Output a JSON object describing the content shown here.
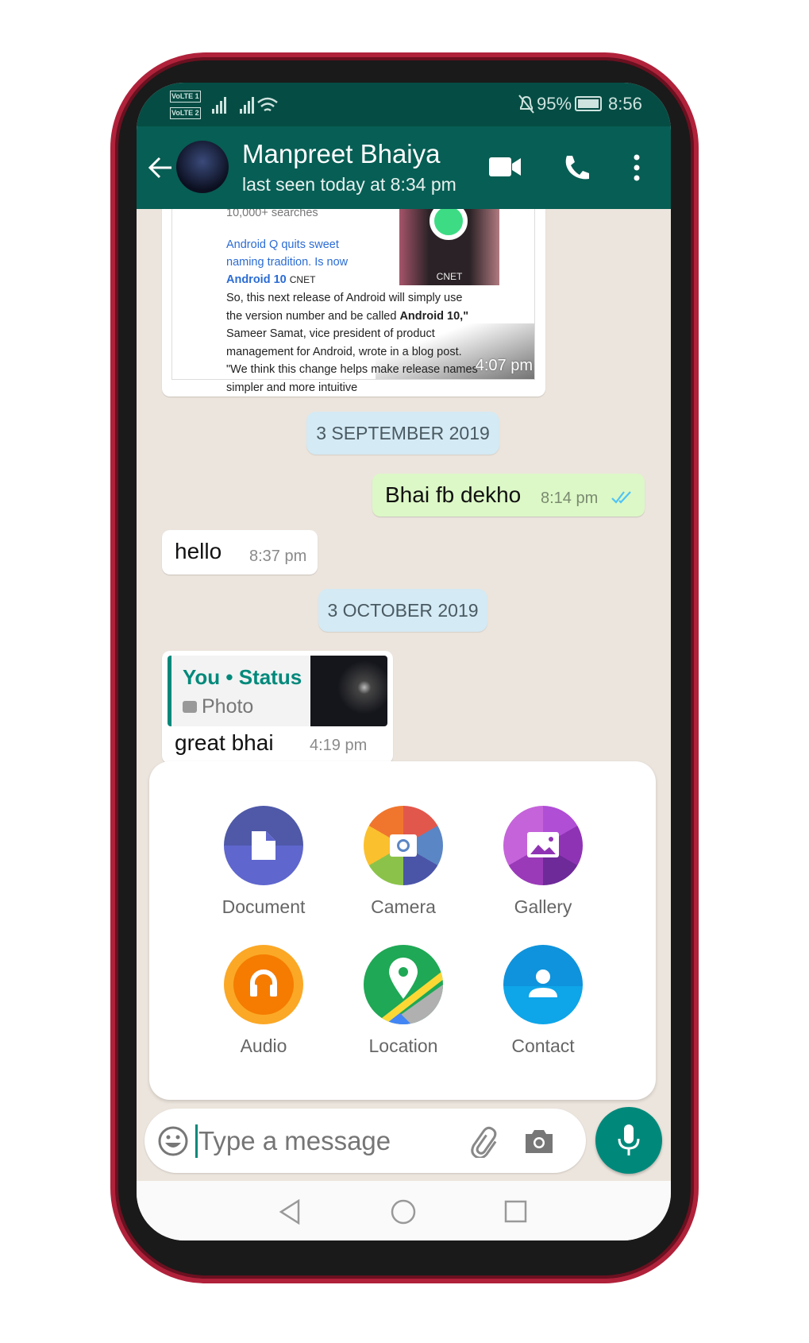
{
  "status_bar": {
    "battery": "95%",
    "time": "8:56",
    "sim1": "VoLTE 1",
    "sim2": "VoLTE 2"
  },
  "header": {
    "contact_name": "Manpreet Bhaiya",
    "last_seen": "last seen today at 8:34 pm",
    "icons": [
      "back-arrow",
      "video-call",
      "voice-call",
      "more-vertical"
    ]
  },
  "messages": {
    "link_preview": {
      "lines": [
        "10,000+ searches",
        "Android Q quits sweet",
        "naming tradition. Is now",
        "Android 10",
        "CNET",
        "So, this next release of Android will simply use",
        "the version number and be called ",
        "Android 10,\"",
        "Sameer Samat, vice president of product",
        "management for Android, wrote in a blog post.",
        "\"We think this change helps make release names",
        "simpler and more intuitive"
      ],
      "image_caption": "CNET",
      "time": "4:07 pm"
    },
    "date1": "3 SEPTEMBER 2019",
    "sent": {
      "text": "Bhai fb dekho",
      "time": "8:14 pm"
    },
    "received": {
      "text": "hello",
      "time": "8:37 pm"
    },
    "date2": "3 OCTOBER 2019",
    "reply": {
      "quote_author": "You • Status",
      "quote_type": "Photo",
      "text": "great bhai",
      "time": "4:19 pm"
    }
  },
  "attach_menu": [
    {
      "label": "Document",
      "color": "#5f66cd"
    },
    {
      "label": "Camera",
      "color": "#e2574c"
    },
    {
      "label": "Gallery",
      "color": "#ac44cf"
    },
    {
      "label": "Audio",
      "color": "#f57c00"
    },
    {
      "label": "Location",
      "color": "#1fa855"
    },
    {
      "label": "Contact",
      "color": "#0ea5e9"
    }
  ],
  "composer": {
    "placeholder": "Type a message"
  },
  "colors": {
    "header": "#075e54",
    "accent": "#00897b",
    "sent_bubble": "#dcf8c6",
    "tick": "#4fc3f7"
  }
}
